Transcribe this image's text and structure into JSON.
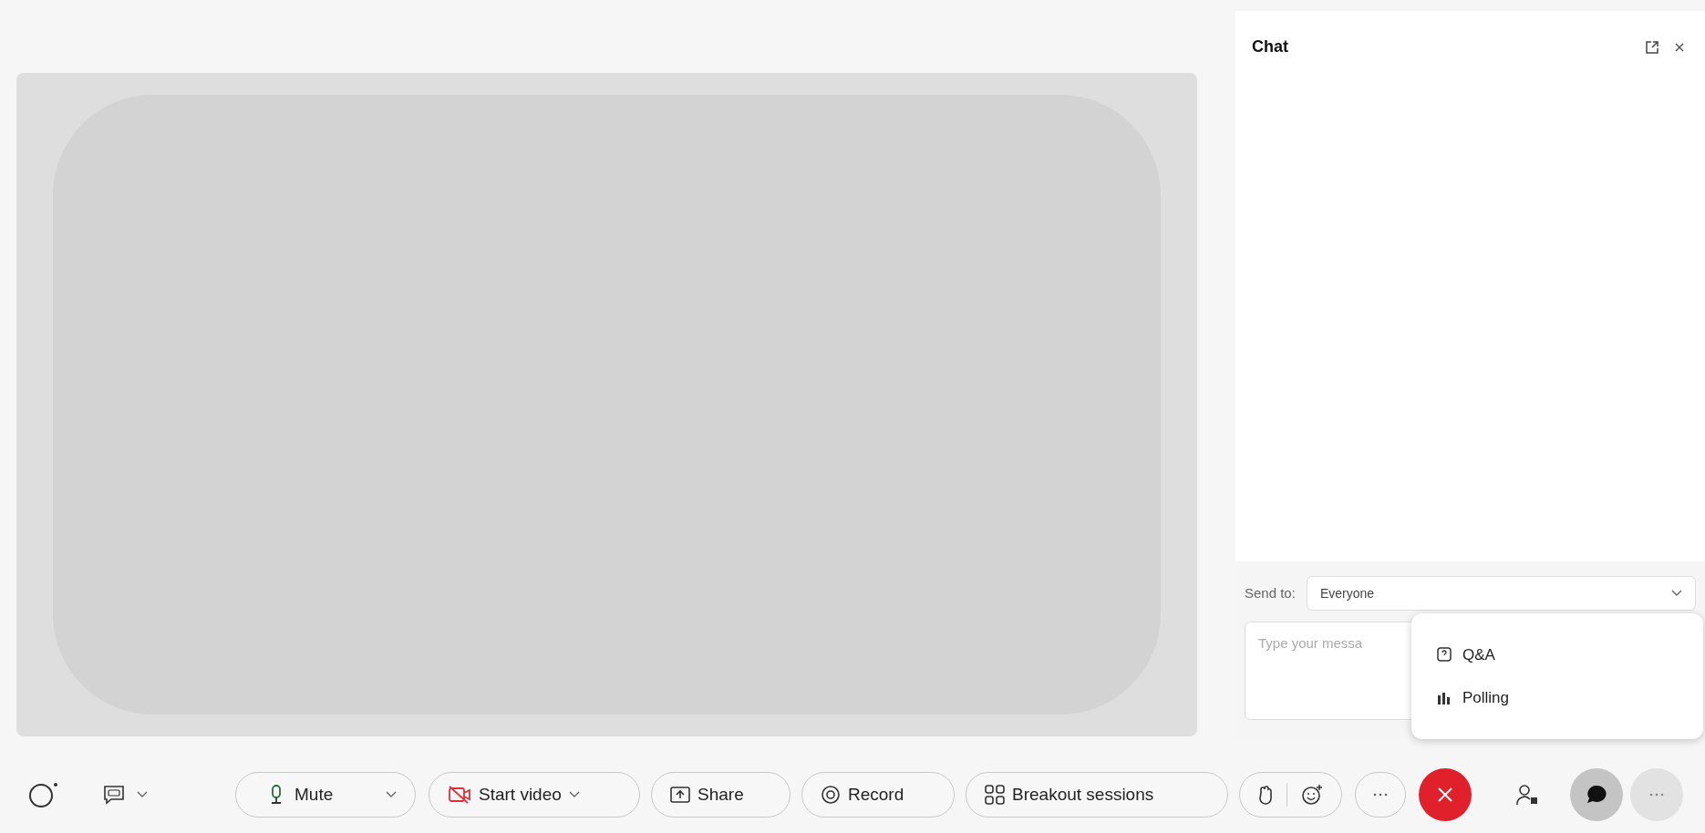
{
  "chat_panel": {
    "title": "Chat",
    "send_to_label": "Send to:",
    "recipient": "Everyone",
    "message_placeholder": "Type your messa"
  },
  "popup_menu": [
    {
      "kind": "qa",
      "label": "Q&A"
    },
    {
      "kind": "polling",
      "label": "Polling"
    }
  ],
  "toolbar": {
    "mute": {
      "label": "Mute"
    },
    "video": {
      "label": "Start video",
      "on": false
    },
    "share": {
      "label": "Share"
    },
    "record": {
      "label": "Record"
    },
    "breakout": {
      "label": "Breakout sessions"
    },
    "chat": {
      "selected": true
    },
    "more": {
      "selected": true
    }
  }
}
